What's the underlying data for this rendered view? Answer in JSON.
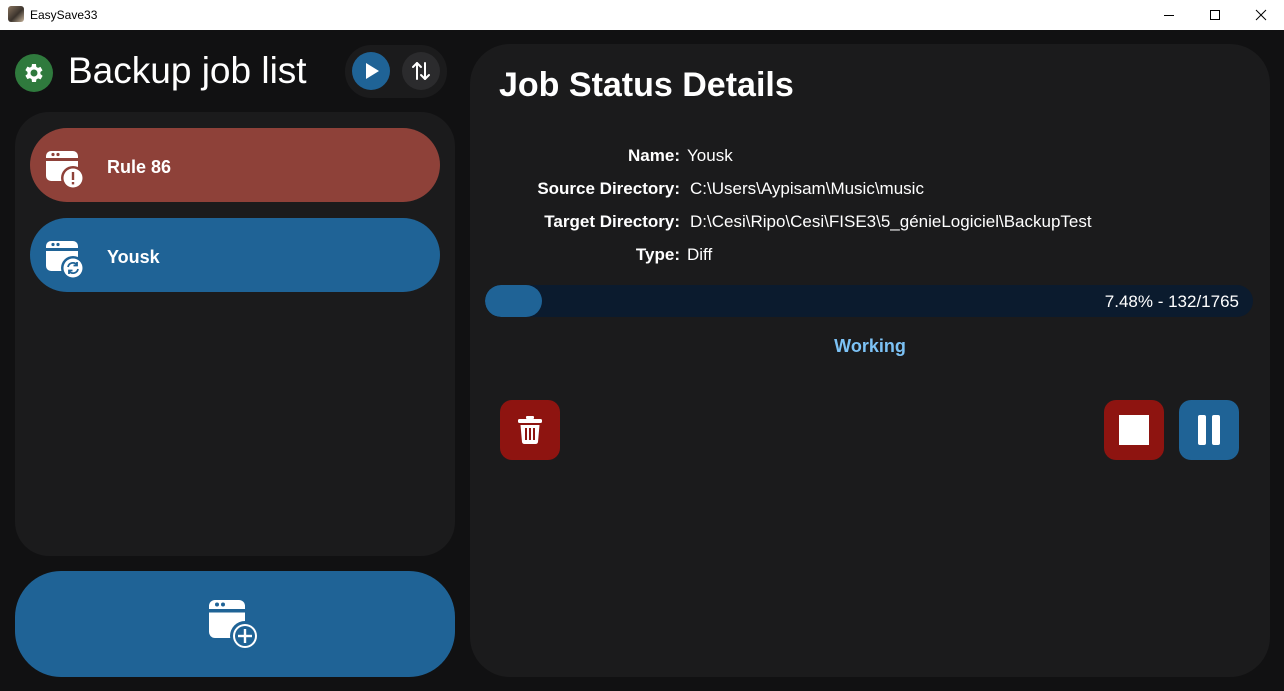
{
  "window": {
    "title": "EasySave33"
  },
  "header": {
    "title": "Backup job list"
  },
  "jobs": [
    {
      "label": "Rule 86",
      "state": "error",
      "color": "#8e4139"
    },
    {
      "label": "Yousk",
      "state": "active",
      "color": "#1f6396"
    }
  ],
  "details": {
    "title": "Job Status Details",
    "name_label": "Name:",
    "name_value": "Yousk",
    "source_label": "Source Directory:",
    "source_value": "C:\\Users\\Aypisam\\Music\\music",
    "target_label": "Target Directory:",
    "target_value": "D:\\Cesi\\Ripo\\Cesi\\FISE3\\5_génieLogiciel\\BackupTest",
    "type_label": "Type:",
    "type_value": "Diff",
    "progress_percent": 7.48,
    "progress_text": "7.48%  -  132/1765",
    "status": "Working"
  },
  "icons": {
    "settings": "gear-icon",
    "play": "play-icon",
    "sort": "sort-arrows-icon",
    "job_error": "calendar-warning-icon",
    "job_active": "calendar-sync-icon",
    "add_job": "calendar-add-icon",
    "delete": "trash-icon",
    "stop": "stop-icon",
    "pause": "pause-icon"
  },
  "colors": {
    "accent_blue": "#1f6396",
    "danger_red": "#8e1410",
    "error_job": "#8e4139",
    "settings_green": "#2f7a3d",
    "status_text": "#7cc2f5",
    "panel": "#1b1b1c",
    "background": "#111112"
  }
}
